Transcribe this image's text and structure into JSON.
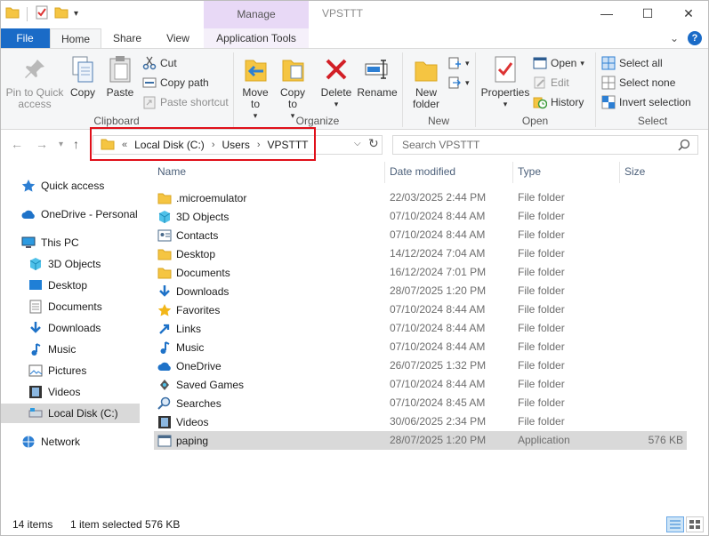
{
  "window": {
    "title": "VPSTTT",
    "manage_label": "Manage",
    "minimize": "—",
    "maximize": "☐",
    "close": "✕"
  },
  "ribbon_tabs": {
    "file": "File",
    "home": "Home",
    "share": "Share",
    "view": "View",
    "app_tools": "Application Tools",
    "expand": "⌄",
    "help": "?"
  },
  "ribbon": {
    "clipboard": {
      "label": "Clipboard",
      "pin": "Pin to Quick access",
      "copy": "Copy",
      "paste": "Paste",
      "cut": "Cut",
      "copy_path": "Copy path",
      "paste_shortcut": "Paste shortcut"
    },
    "organize": {
      "label": "Organize",
      "move_to": "Move to",
      "copy_to": "Copy to",
      "delete": "Delete",
      "rename": "Rename"
    },
    "new": {
      "label": "New",
      "new_folder": "New folder"
    },
    "open": {
      "label": "Open",
      "properties": "Properties",
      "open": "Open",
      "edit": "Edit",
      "history": "History"
    },
    "select": {
      "label": "Select",
      "select_all": "Select all",
      "select_none": "Select none",
      "invert_selection": "Invert selection"
    }
  },
  "address": {
    "overflow": "«",
    "crumbs": [
      "Local Disk (C:)",
      "Users",
      "VPSTTT"
    ],
    "separator": "›",
    "search_placeholder": "Search VPSTTT"
  },
  "nav": {
    "quick_access": "Quick access",
    "onedrive": "OneDrive - Personal",
    "this_pc": "This PC",
    "objects_3d": "3D Objects",
    "desktop": "Desktop",
    "documents": "Documents",
    "downloads": "Downloads",
    "music": "Music",
    "pictures": "Pictures",
    "videos": "Videos",
    "local_disk": "Local Disk (C:)",
    "network": "Network"
  },
  "columns": {
    "name": "Name",
    "date": "Date modified",
    "type": "Type",
    "size": "Size"
  },
  "files": [
    {
      "name": ".microemulator",
      "date": "22/03/2025 2:44 PM",
      "type": "File folder",
      "size": "",
      "icon": "folder"
    },
    {
      "name": "3D Objects",
      "date": "07/10/2024 8:44 AM",
      "type": "File folder",
      "size": "",
      "icon": "cube"
    },
    {
      "name": "Contacts",
      "date": "07/10/2024 8:44 AM",
      "type": "File folder",
      "size": "",
      "icon": "contacts"
    },
    {
      "name": "Desktop",
      "date": "14/12/2024 7:04 AM",
      "type": "File folder",
      "size": "",
      "icon": "folder"
    },
    {
      "name": "Documents",
      "date": "16/12/2024 7:01 PM",
      "type": "File folder",
      "size": "",
      "icon": "folder"
    },
    {
      "name": "Downloads",
      "date": "28/07/2025 1:20 PM",
      "type": "File folder",
      "size": "",
      "icon": "download"
    },
    {
      "name": "Favorites",
      "date": "07/10/2024 8:44 AM",
      "type": "File folder",
      "size": "",
      "icon": "star"
    },
    {
      "name": "Links",
      "date": "07/10/2024 8:44 AM",
      "type": "File folder",
      "size": "",
      "icon": "link"
    },
    {
      "name": "Music",
      "date": "07/10/2024 8:44 AM",
      "type": "File folder",
      "size": "",
      "icon": "music"
    },
    {
      "name": "OneDrive",
      "date": "26/07/2025 1:32 PM",
      "type": "File folder",
      "size": "",
      "icon": "cloud"
    },
    {
      "name": "Saved Games",
      "date": "07/10/2024 8:44 AM",
      "type": "File folder",
      "size": "",
      "icon": "games"
    },
    {
      "name": "Searches",
      "date": "07/10/2024 8:45 AM",
      "type": "File folder",
      "size": "",
      "icon": "search"
    },
    {
      "name": "Videos",
      "date": "30/06/2025 2:34 PM",
      "type": "File folder",
      "size": "",
      "icon": "video"
    },
    {
      "name": "paping",
      "date": "28/07/2025 1:20 PM",
      "type": "Application",
      "size": "576 KB",
      "icon": "app"
    }
  ],
  "status": {
    "items": "14 items",
    "selected": "1 item selected  576 KB"
  }
}
